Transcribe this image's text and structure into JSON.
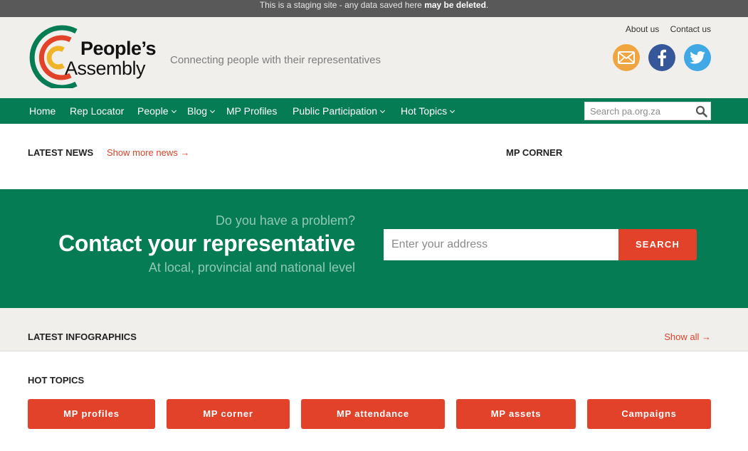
{
  "staging": {
    "prefix": "This is a staging site - any data saved here ",
    "bold": "may be deleted",
    "suffix": "."
  },
  "brand": {
    "logo_line1": "People’s",
    "logo_line2": "Assembly",
    "tagline": "Connecting people with their representatives",
    "colors": {
      "green": "#067c55",
      "red": "#e2412a",
      "orange": "#f0a640",
      "facebook": "#36589b",
      "twitter": "#41a8e6"
    }
  },
  "toplinks": [
    {
      "label": "About us"
    },
    {
      "label": "Contact us"
    }
  ],
  "social": [
    {
      "icon": "mail-icon"
    },
    {
      "icon": "facebook-icon"
    },
    {
      "icon": "twitter-icon"
    }
  ],
  "nav": {
    "items": [
      {
        "label": "Home",
        "has_dropdown": false
      },
      {
        "label": "Rep Locator",
        "has_dropdown": false
      },
      {
        "label": "People",
        "has_dropdown": true
      },
      {
        "label": "Blog",
        "has_dropdown": true
      },
      {
        "label": "MP Profiles",
        "has_dropdown": false
      },
      {
        "label": "Public Participation",
        "has_dropdown": true
      },
      {
        "label": "Hot Topics",
        "has_dropdown": true
      }
    ],
    "search_placeholder": "Search pa.org.za"
  },
  "news": {
    "heading": "LATEST NEWS",
    "more_link": "Show more news →",
    "mp_corner_heading": "MP CORNER"
  },
  "hero": {
    "question": "Do you have a problem?",
    "title": "Contact your representative",
    "subtitle": "At local, provincial and national level",
    "address_placeholder": "Enter your address",
    "search_label": "SEARCH"
  },
  "infographics": {
    "heading": "LATEST INFOGRAPHICS",
    "show_all": "Show all →"
  },
  "hot_topics": {
    "heading": "HOT TOPICS",
    "buttons": [
      {
        "label": "MP profiles"
      },
      {
        "label": "MP corner"
      },
      {
        "label": "MP attendance"
      },
      {
        "label": "MP assets"
      },
      {
        "label": "Campaigns"
      }
    ]
  }
}
